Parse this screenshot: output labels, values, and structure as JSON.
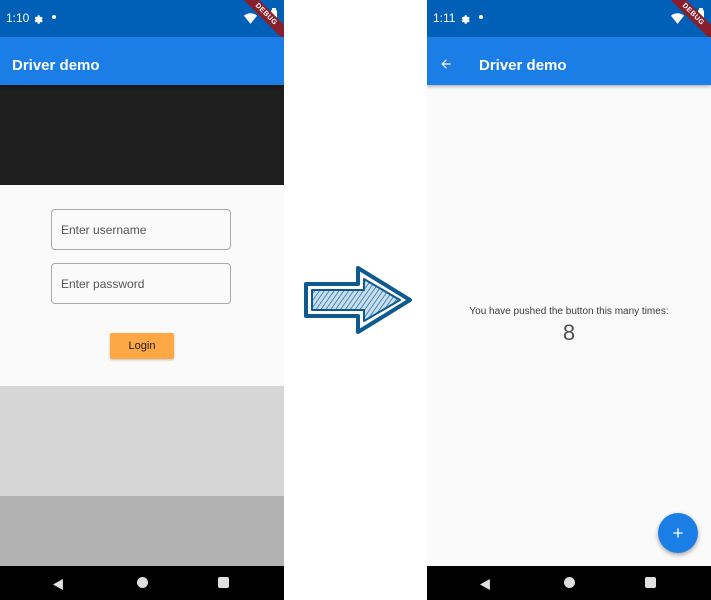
{
  "left_screen": {
    "status_bar": {
      "time": "1:10",
      "debug_label": "DEBUG",
      "icons": [
        "gear-icon",
        "notification-dot-icon",
        "wifi-icon",
        "battery-icon"
      ]
    },
    "app_bar": {
      "title": "Driver demo"
    },
    "username_field": {
      "placeholder": "Enter username",
      "value": ""
    },
    "password_field": {
      "placeholder": "Enter password",
      "value": ""
    },
    "login_button": {
      "label": "Login"
    },
    "nav_bar": {
      "icons": [
        "back-triangle-icon",
        "home-circle-icon",
        "recents-square-icon"
      ]
    }
  },
  "right_screen": {
    "status_bar": {
      "time": "1:11",
      "debug_label": "DEBUG",
      "icons": [
        "gear-icon",
        "notification-dot-icon",
        "wifi-icon",
        "battery-icon"
      ]
    },
    "app_bar": {
      "title": "Driver demo",
      "back_icon": "back-arrow-icon"
    },
    "counter": {
      "label": "You have pushed the button this many times:",
      "value": "8"
    },
    "fab": {
      "icon": "plus-icon"
    },
    "nav_bar": {
      "icons": [
        "back-triangle-icon",
        "home-circle-icon",
        "recents-square-icon"
      ]
    }
  },
  "transition": {
    "icon": "right-arrow-icon"
  },
  "colors": {
    "status_bar": "#0060b8",
    "app_bar": "#1a7ee6",
    "login_button": "#fea845",
    "fab": "#1a7ee6",
    "arrow_fill": "#1f6fa6"
  }
}
